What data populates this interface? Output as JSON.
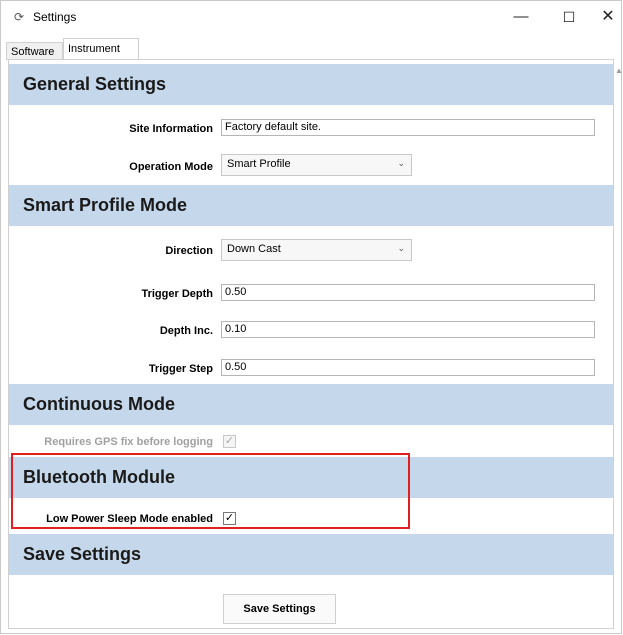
{
  "window": {
    "title": "Settings",
    "controls": {
      "minimize": "—",
      "maximize": "☐",
      "close": "✕"
    }
  },
  "tabs": [
    {
      "label": "Software",
      "selected": false
    },
    {
      "label": "Instrument",
      "selected": true
    }
  ],
  "general": {
    "heading": "General Settings",
    "site_label": "Site Information",
    "site_value": "Factory default site.",
    "mode_label": "Operation Mode",
    "mode_value": "Smart Profile"
  },
  "smart_profile": {
    "heading": "Smart Profile Mode",
    "direction_label": "Direction",
    "direction_value": "Down Cast",
    "trigger_depth_label": "Trigger Depth",
    "trigger_depth_value": "0.50",
    "depth_inc_label": "Depth Inc.",
    "depth_inc_value": "0.10",
    "trigger_step_label": "Trigger Step",
    "trigger_step_value": "0.50"
  },
  "continuous": {
    "heading": "Continuous Mode",
    "gps_label": "Requires GPS fix before logging",
    "gps_checked": true,
    "gps_enabled": false
  },
  "bluetooth": {
    "heading": "Bluetooth Module",
    "sleep_label": "Low Power Sleep Mode enabled",
    "sleep_checked": true
  },
  "save": {
    "heading": "Save Settings",
    "button_label": "Save Settings"
  },
  "icons": {
    "check": "✓",
    "chevron": "⌄",
    "app": "⟳",
    "scroll_up": "▲"
  },
  "colors": {
    "section_bg": "#c5d8eb",
    "highlight": "#e02020"
  }
}
